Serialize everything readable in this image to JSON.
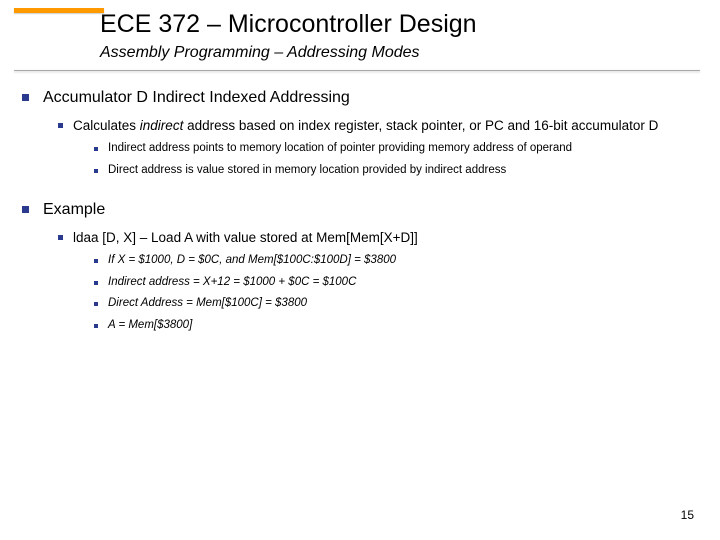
{
  "title": "ECE 372 – Microcontroller Design",
  "subtitle": "Assembly Programming – Addressing Modes",
  "sections": [
    {
      "heading": "Accumulator D Indirect Indexed Addressing",
      "sub": {
        "pre": "Calculates ",
        "italic": "indirect",
        "post": " address based on index register, stack pointer, or PC and 16-bit accumulator D",
        "points": [
          "Indirect address points to memory location of pointer providing memory address of operand",
          "Direct address is value stored in memory location provided by indirect address"
        ]
      }
    },
    {
      "heading": "Example",
      "sub": {
        "plain": "ldaa [D, X] – Load A with value stored at Mem[Mem[X+D]]",
        "points_italic": [
          "If X = $1000, D = $0C, and Mem[$100C:$100D] = $3800",
          "Indirect address = X+12 = $1000 + $0C = $100C",
          "Direct Address = Mem[$100C] = $3800",
          "A = Mem[$3800]"
        ]
      }
    }
  ],
  "page_number": "15"
}
